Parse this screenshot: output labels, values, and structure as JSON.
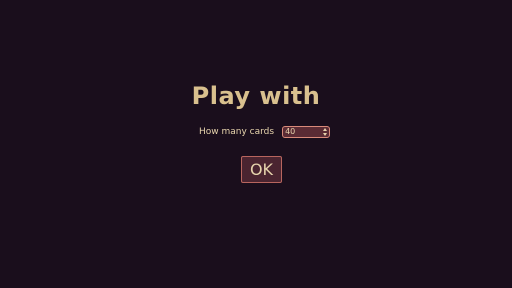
{
  "dialog": {
    "title": "Play with",
    "card_count_label": "How many cards",
    "card_count_value": "40",
    "ok_label": "OK"
  },
  "colors": {
    "background": "#1a0e1c",
    "title_text": "#d9c08e",
    "text": "#e6d3ac",
    "select_background": "#5a2b34",
    "select_border": "#d98a7a",
    "button_background": "#4a2430",
    "button_border": "#b8655e"
  },
  "icons": {
    "select_arrows": "up-down-chevron-icon"
  }
}
